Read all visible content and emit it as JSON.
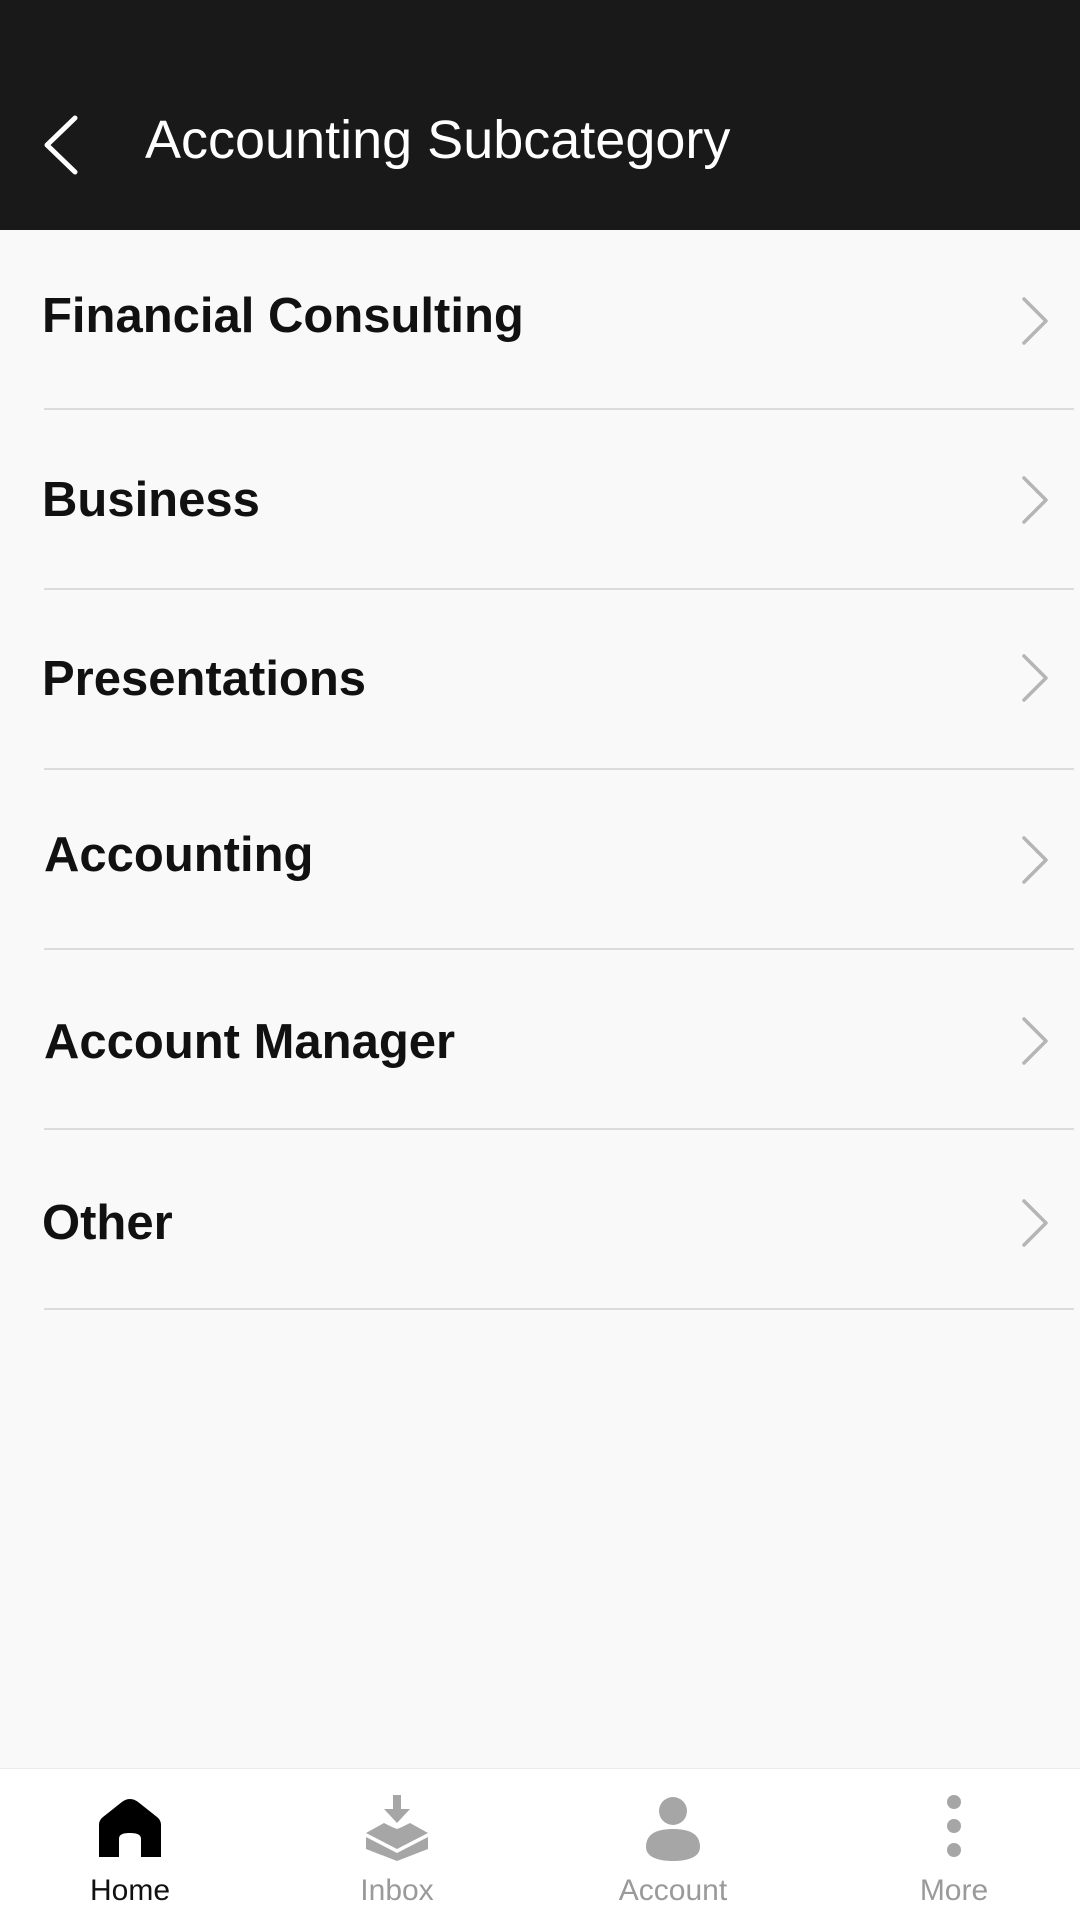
{
  "header": {
    "title": "Accounting Subcategory",
    "back_icon": "chevron-left-icon"
  },
  "list": {
    "items": [
      {
        "label": "Financial Consulting"
      },
      {
        "label": "Business"
      },
      {
        "label": "Presentations"
      },
      {
        "label": "Accounting"
      },
      {
        "label": "Account Manager"
      },
      {
        "label": "Other"
      }
    ],
    "chevron_icon": "chevron-right-icon"
  },
  "bottom_nav": {
    "items": [
      {
        "label": "Home",
        "icon": "home-icon",
        "active": true
      },
      {
        "label": "Inbox",
        "icon": "inbox-icon",
        "active": false
      },
      {
        "label": "Account",
        "icon": "account-icon",
        "active": false
      },
      {
        "label": "More",
        "icon": "more-vertical-icon",
        "active": false
      }
    ]
  },
  "colors": {
    "header_bg": "#191919",
    "page_bg": "#f9f9f9",
    "active_nav": "#111111",
    "inactive_nav": "#9a9a9a",
    "chevron": "#b5b5b5",
    "divider": "#dcdcdc"
  }
}
